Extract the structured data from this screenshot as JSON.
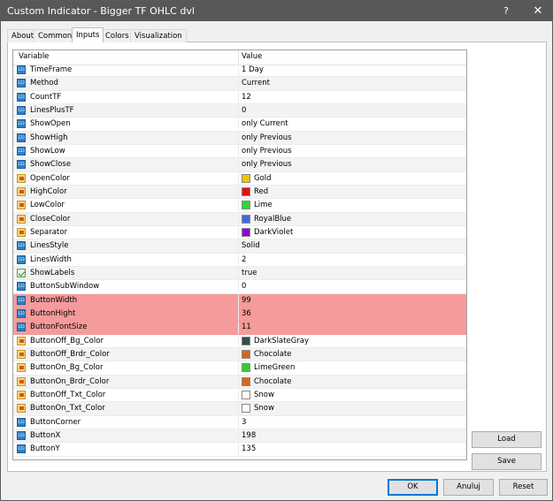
{
  "window": {
    "title": "Custom Indicator - Bigger TF OHLC dvl",
    "help_label": "?",
    "close_label": "✕"
  },
  "tabs": [
    "About",
    "Common",
    "Inputs",
    "Colors",
    "Visualization"
  ],
  "active_tab": "Inputs",
  "grid": {
    "headers": {
      "variable": "Variable",
      "value": "Value"
    },
    "rows": [
      {
        "icon": "num",
        "name": "TimeFrame",
        "value": "1 Day"
      },
      {
        "icon": "num",
        "name": "Method",
        "value": "Current"
      },
      {
        "icon": "num",
        "name": "CountTF",
        "value": "12"
      },
      {
        "icon": "num",
        "name": "LinesPlusTF",
        "value": "0"
      },
      {
        "icon": "num",
        "name": "ShowOpen",
        "value": "only Current"
      },
      {
        "icon": "num",
        "name": "ShowHigh",
        "value": "only Previous"
      },
      {
        "icon": "num",
        "name": "ShowLow",
        "value": "only Previous"
      },
      {
        "icon": "num",
        "name": "ShowClose",
        "value": "only Previous"
      },
      {
        "icon": "color",
        "name": "OpenColor",
        "value": "Gold",
        "swatch": "#f2c200"
      },
      {
        "icon": "color",
        "name": "HighColor",
        "value": "Red",
        "swatch": "#e01010"
      },
      {
        "icon": "color",
        "name": "LowColor",
        "value": "Lime",
        "swatch": "#2ed82e"
      },
      {
        "icon": "color",
        "name": "CloseColor",
        "value": "RoyalBlue",
        "swatch": "#4169e1"
      },
      {
        "icon": "color",
        "name": "Separator",
        "value": "DarkViolet",
        "swatch": "#9400d3"
      },
      {
        "icon": "num",
        "name": "LinesStyle",
        "value": "Solid"
      },
      {
        "icon": "num",
        "name": "LinesWidth",
        "value": "2"
      },
      {
        "icon": "bool",
        "name": "ShowLabels",
        "value": "true"
      },
      {
        "icon": "num",
        "name": "ButtonSubWindow",
        "value": "0"
      },
      {
        "icon": "num",
        "name": "ButtonWidth",
        "value": "99",
        "highlight": true
      },
      {
        "icon": "num",
        "name": "ButtonHight",
        "value": "36",
        "highlight": true
      },
      {
        "icon": "num",
        "name": "ButtonFontSize",
        "value": "11",
        "highlight": true
      },
      {
        "icon": "color",
        "name": "ButtonOff_Bg_Color",
        "value": "DarkSlateGray",
        "swatch": "#2f4f4f"
      },
      {
        "icon": "color",
        "name": "ButtonOff_Brdr_Color",
        "value": "Chocolate",
        "swatch": "#d2691e"
      },
      {
        "icon": "color",
        "name": "ButtonOn_Bg_Color",
        "value": "LimeGreen",
        "swatch": "#32cd32"
      },
      {
        "icon": "color",
        "name": "ButtonOn_Brdr_Color",
        "value": "Chocolate",
        "swatch": "#d2691e"
      },
      {
        "icon": "color",
        "name": "ButtonOff_Txt_Color",
        "value": "Snow",
        "swatch": "#fffafa"
      },
      {
        "icon": "color",
        "name": "ButtonOn_Txt_Color",
        "value": "Snow",
        "swatch": "#fffafa"
      },
      {
        "icon": "num",
        "name": "ButtonCorner",
        "value": "3"
      },
      {
        "icon": "num",
        "name": "ButtonX",
        "value": "198"
      },
      {
        "icon": "num",
        "name": "ButtonY",
        "value": "135"
      }
    ]
  },
  "side_buttons": {
    "load": "Load",
    "save": "Save"
  },
  "footer_buttons": {
    "ok": "OK",
    "cancel": "Anuluj",
    "reset": "Reset"
  },
  "colors": {
    "titlebar": "#585858",
    "highlight": "#f59b9b",
    "accent": "#0078d7"
  }
}
